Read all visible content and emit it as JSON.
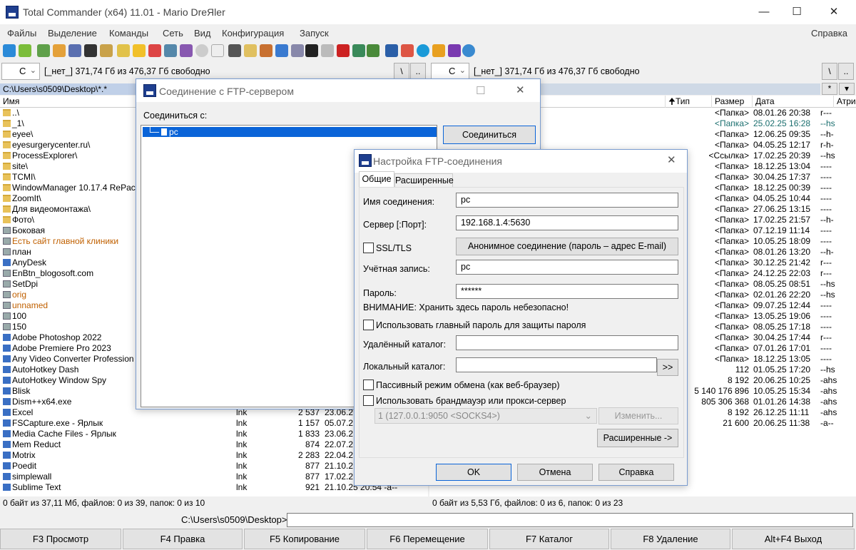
{
  "window": {
    "title": "Total Commander (x64) 11.01 - Mario DreЯler"
  },
  "menu": {
    "items": [
      "Файлы",
      "Выделение",
      "Команды",
      "Сеть",
      "Вид",
      "Конфигурация",
      "Запуск"
    ],
    "help": "Справка"
  },
  "left_panel": {
    "drive": "C",
    "drive_info": "[_нет_]  371,74 Гб из 476,37 Гб свободно",
    "path": "C:\\Users\\s0509\\Desktop\\*.*",
    "col_name": "Имя",
    "status": "0 байт из 37,11 Мб, файлов: 0 из 39, папок: 0 из 10",
    "rows": [
      {
        "n": "..\\",
        "t": "up"
      },
      {
        "n": "_1\\",
        "t": "folder"
      },
      {
        "n": "eyee\\",
        "t": "folder"
      },
      {
        "n": "eyesurgerycenter.ru\\",
        "t": "folder"
      },
      {
        "n": "ProcessExplorer\\",
        "t": "folder"
      },
      {
        "n": "site\\",
        "t": "folder"
      },
      {
        "n": "TCMI\\",
        "t": "folder"
      },
      {
        "n": "WindowManager 10.17.4 RePac",
        "t": "folder"
      },
      {
        "n": "ZoomIt\\",
        "t": "folder"
      },
      {
        "n": "Для видеомонтажа\\",
        "t": "folder"
      },
      {
        "n": "Фото\\",
        "t": "folder"
      },
      {
        "n": "Боковая",
        "t": "file"
      },
      {
        "n": "Есть сайт главной клиники",
        "t": "file",
        "c": "#c06000"
      },
      {
        "n": "план",
        "t": "file"
      },
      {
        "n": "AnyDesk",
        "t": "exe"
      },
      {
        "n": "EnBtn_blogosoft.com",
        "t": "file"
      },
      {
        "n": "SetDpi",
        "t": "file"
      },
      {
        "n": "orig",
        "t": "file",
        "c": "#c06000"
      },
      {
        "n": "unnamed",
        "t": "file",
        "c": "#c06000"
      },
      {
        "n": "100",
        "t": "file"
      },
      {
        "n": "150",
        "t": "file"
      },
      {
        "n": "Adobe Photoshop 2022",
        "t": "exe"
      },
      {
        "n": "Adobe Premiere Pro 2023",
        "t": "exe"
      },
      {
        "n": "Any Video Converter Profession",
        "t": "exe"
      },
      {
        "n": "AutoHotkey Dash",
        "t": "exe"
      },
      {
        "n": "AutoHotkey Window Spy",
        "t": "exe"
      },
      {
        "n": "Blisk",
        "t": "exe"
      },
      {
        "n": "Dism++x64.exe",
        "t": "exe"
      },
      {
        "n": "Excel",
        "t": "exe",
        "e": "lnk",
        "s": "2 537",
        "d": "23.06.2"
      },
      {
        "n": "FSCapture.exe - Ярлык",
        "t": "exe",
        "e": "lnk",
        "s": "1 157",
        "d": "05.07.2"
      },
      {
        "n": "Media Cache Files - Ярлык",
        "t": "exe",
        "e": "lnk",
        "s": "1 833",
        "d": "23.06.2"
      },
      {
        "n": "Mem Reduct",
        "t": "exe",
        "e": "lnk",
        "s": "874",
        "d": "22.07.2"
      },
      {
        "n": "Motrix",
        "t": "exe",
        "e": "lnk",
        "s": "2 283",
        "d": "22.04.2"
      },
      {
        "n": "Poedit",
        "t": "exe",
        "e": "lnk",
        "s": "877",
        "d": "21.10.2"
      },
      {
        "n": "simplewall",
        "t": "exe",
        "e": "lnk",
        "s": "877",
        "d": "17.02.2"
      },
      {
        "n": "Sublime Text",
        "t": "exe",
        "e": "lnk",
        "s": "921",
        "d": "21.10.25 20:54 -a--"
      }
    ]
  },
  "right_panel": {
    "drive": "C",
    "drive_info": "[_нет_]  371,74 Гб из 476,37 Гб свободно",
    "cols": {
      "type": "Тип",
      "size": "Размер",
      "date": "Дата",
      "attr": "Атрибу"
    },
    "status": "0 байт из 5,53 Гб, файлов: 0 из 6, папок: 0 из 23",
    "rows": [
      {
        "s": "<Папка>",
        "d": "08.01.26 20:38",
        "a": "r---"
      },
      {
        "s": "<Папка>",
        "d": "25.02.25 16:28",
        "a": "--hs",
        "c": "#1a6e6e"
      },
      {
        "s": "<Папка>",
        "d": "12.06.25 09:35",
        "a": "--h-"
      },
      {
        "s": "<Папка>",
        "d": "04.05.25 12:17",
        "a": "r-h-"
      },
      {
        "s": "<Ссылка>",
        "d": "17.02.25 20:39",
        "a": "--hs"
      },
      {
        "s": "<Папка>",
        "d": "18.12.25 13:04",
        "a": "----"
      },
      {
        "s": "<Папка>",
        "d": "30.04.25 17:37",
        "a": "----"
      },
      {
        "s": "<Папка>",
        "d": "18.12.25 00:39",
        "a": "----"
      },
      {
        "s": "<Папка>",
        "d": "04.05.25 10:44",
        "a": "----"
      },
      {
        "s": "<Папка>",
        "d": "27.06.25 13:15",
        "a": "----"
      },
      {
        "s": "<Папка>",
        "d": "17.02.25 21:57",
        "a": "--h-"
      },
      {
        "s": "<Папка>",
        "d": "07.12.19 11:14",
        "a": "----"
      },
      {
        "s": "<Папка>",
        "d": "10.05.25 18:09",
        "a": "----"
      },
      {
        "s": "<Папка>",
        "d": "08.01.26 13:20",
        "a": "--h-"
      },
      {
        "s": "<Папка>",
        "d": "30.12.25 21:42",
        "a": "r---"
      },
      {
        "s": "<Папка>",
        "d": "24.12.25 22:03",
        "a": "r---"
      },
      {
        "s": "<Папка>",
        "d": "08.05.25 08:51",
        "a": "--hs"
      },
      {
        "s": "<Папка>",
        "d": "02.01.26 22:20",
        "a": "--hs"
      },
      {
        "s": "<Папка>",
        "d": "09.07.25 12:44",
        "a": "----"
      },
      {
        "s": "<Папка>",
        "d": "13.05.25 19:06",
        "a": "----"
      },
      {
        "s": "<Папка>",
        "d": "08.05.25 17:18",
        "a": "----"
      },
      {
        "s": "<Папка>",
        "d": "30.04.25 17:44",
        "a": "r---"
      },
      {
        "s": "<Папка>",
        "d": "07.01.26 17:01",
        "a": "----"
      },
      {
        "s": "<Папка>",
        "d": "18.12.25 13:05",
        "a": "----"
      },
      {
        "s": "112",
        "d": "01.05.25 17:20",
        "a": "--hs"
      },
      {
        "s": "8 192",
        "d": "20.06.25 10:25",
        "a": "-ahs"
      },
      {
        "s": "5 140 176 896",
        "d": "10.05.25 15:34",
        "a": "-ahs"
      },
      {
        "s": "805 306 368",
        "d": "01.01.26 14:38",
        "a": "-ahs"
      },
      {
        "s": "8 192",
        "d": "26.12.25 11:11",
        "a": "-ahs"
      },
      {
        "s": "21 600",
        "d": "20.06.25 11:38",
        "a": "-a--"
      }
    ]
  },
  "cmd": {
    "path": "C:\\Users\\s0509\\Desktop>"
  },
  "fkeys": [
    "F3 Просмотр",
    "F4 Правка",
    "F5 Копирование",
    "F6 Перемещение",
    "F7 Каталог",
    "F8 Удаление",
    "Alt+F4 Выход"
  ],
  "ftp_connect": {
    "title": "Соединение с FTP-сервером",
    "label": "Соединиться с:",
    "item": "pc",
    "connect_btn": "Соединиться"
  },
  "ftp_settings": {
    "title": "Настройка FTP-соединения",
    "tab_general": "Общие",
    "tab_advanced": "Расширенные",
    "lbl_name": "Имя соединения:",
    "val_name": "pc",
    "lbl_server": "Сервер [:Порт]:",
    "val_server": "192.168.1.4:5630",
    "lbl_ssl": "SSL/TLS",
    "anon_btn": "Анонимное соединение (пароль – адрес E-mail)",
    "lbl_account": "Учётная запись:",
    "val_account": "pc",
    "lbl_password": "Пароль:",
    "val_password": "******",
    "warning": "ВНИМАНИЕ: Хранить здесь пароль небезопасно!",
    "lbl_master": "Использовать главный пароль для защиты пароля",
    "lbl_remote": "Удалённый каталог:",
    "lbl_local": "Локальный каталог:",
    "browse_btn": ">>",
    "lbl_passive": "Пассивный режим обмена (как веб-браузер)",
    "lbl_proxy": "Использовать брандмауэр или прокси-сервер",
    "proxy_value": "1 (127.0.0.1:9050 <SOCKS4>)",
    "change_btn": "Изменить...",
    "advanced_btn": "Расширенные ->",
    "ok": "OK",
    "cancel": "Отмена",
    "help": "Справка"
  }
}
